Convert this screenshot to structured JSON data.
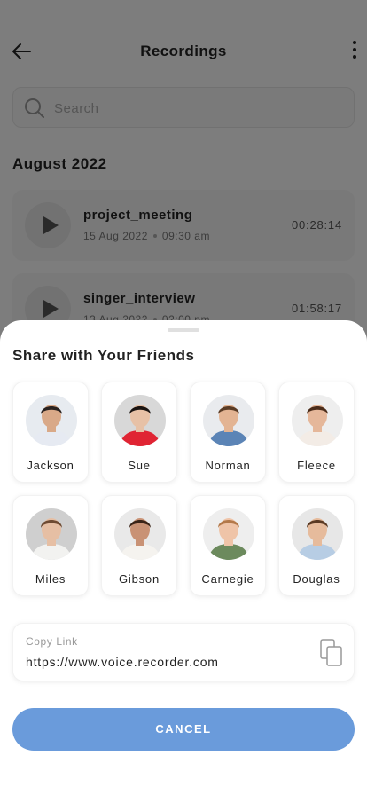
{
  "header": {
    "title": "Recordings"
  },
  "search": {
    "placeholder": "Search",
    "value": ""
  },
  "section": {
    "title": "August 2022"
  },
  "recordings": [
    {
      "name": "project_meeting",
      "date": "15 Aug 2022",
      "time": "09:30 am",
      "duration": "00:28:14"
    },
    {
      "name": "singer_interview",
      "date": "13 Aug 2022",
      "time": "02:00 pm",
      "duration": "01:58:17"
    }
  ],
  "share": {
    "title": "Share with Your Friends",
    "friends": [
      {
        "name": "Jackson",
        "shirt": "#e6eaf2",
        "hair": "#2a2220",
        "skin": "#d9a988",
        "bg": "#e7ebf0"
      },
      {
        "name": "Sue",
        "shirt": "#e02433",
        "hair": "#1a1412",
        "skin": "#e7c1a6",
        "bg": "#d8d8d8"
      },
      {
        "name": "Norman",
        "shirt": "#5b84b6",
        "hair": "#5a3c26",
        "skin": "#e3b493",
        "bg": "#e9ebee"
      },
      {
        "name": "Fleece",
        "shirt": "#f3ece6",
        "hair": "#4a2c1a",
        "skin": "#e5b79a",
        "bg": "#eeeeee"
      },
      {
        "name": "Miles",
        "shirt": "#f2f2f0",
        "hair": "#6e4b33",
        "skin": "#e6bfa4",
        "bg": "#cfcfcf"
      },
      {
        "name": "Gibson",
        "shirt": "#f5f3ef",
        "hair": "#3a2418",
        "skin": "#c99275",
        "bg": "#e9e9e9"
      },
      {
        "name": "Carnegie",
        "shirt": "#6c8a5d",
        "hair": "#b3794a",
        "skin": "#efc4a8",
        "bg": "#eeeeee"
      },
      {
        "name": "Douglas",
        "shirt": "#b7cde4",
        "hair": "#5a3a24",
        "skin": "#e6bb9c",
        "bg": "#e7e7e7"
      }
    ]
  },
  "copy_link": {
    "label": "Copy Link",
    "url": "https://www.voice.recorder.com"
  },
  "cancel": {
    "label": "CANCEL"
  },
  "colors": {
    "accent": "#6a9bdb",
    "overlay": "rgba(0,0,0,0.5)"
  },
  "icons": {
    "back": "arrow-left-icon",
    "more": "more-vertical-icon",
    "search": "search-icon",
    "play": "play-icon",
    "copy": "copy-icon"
  }
}
